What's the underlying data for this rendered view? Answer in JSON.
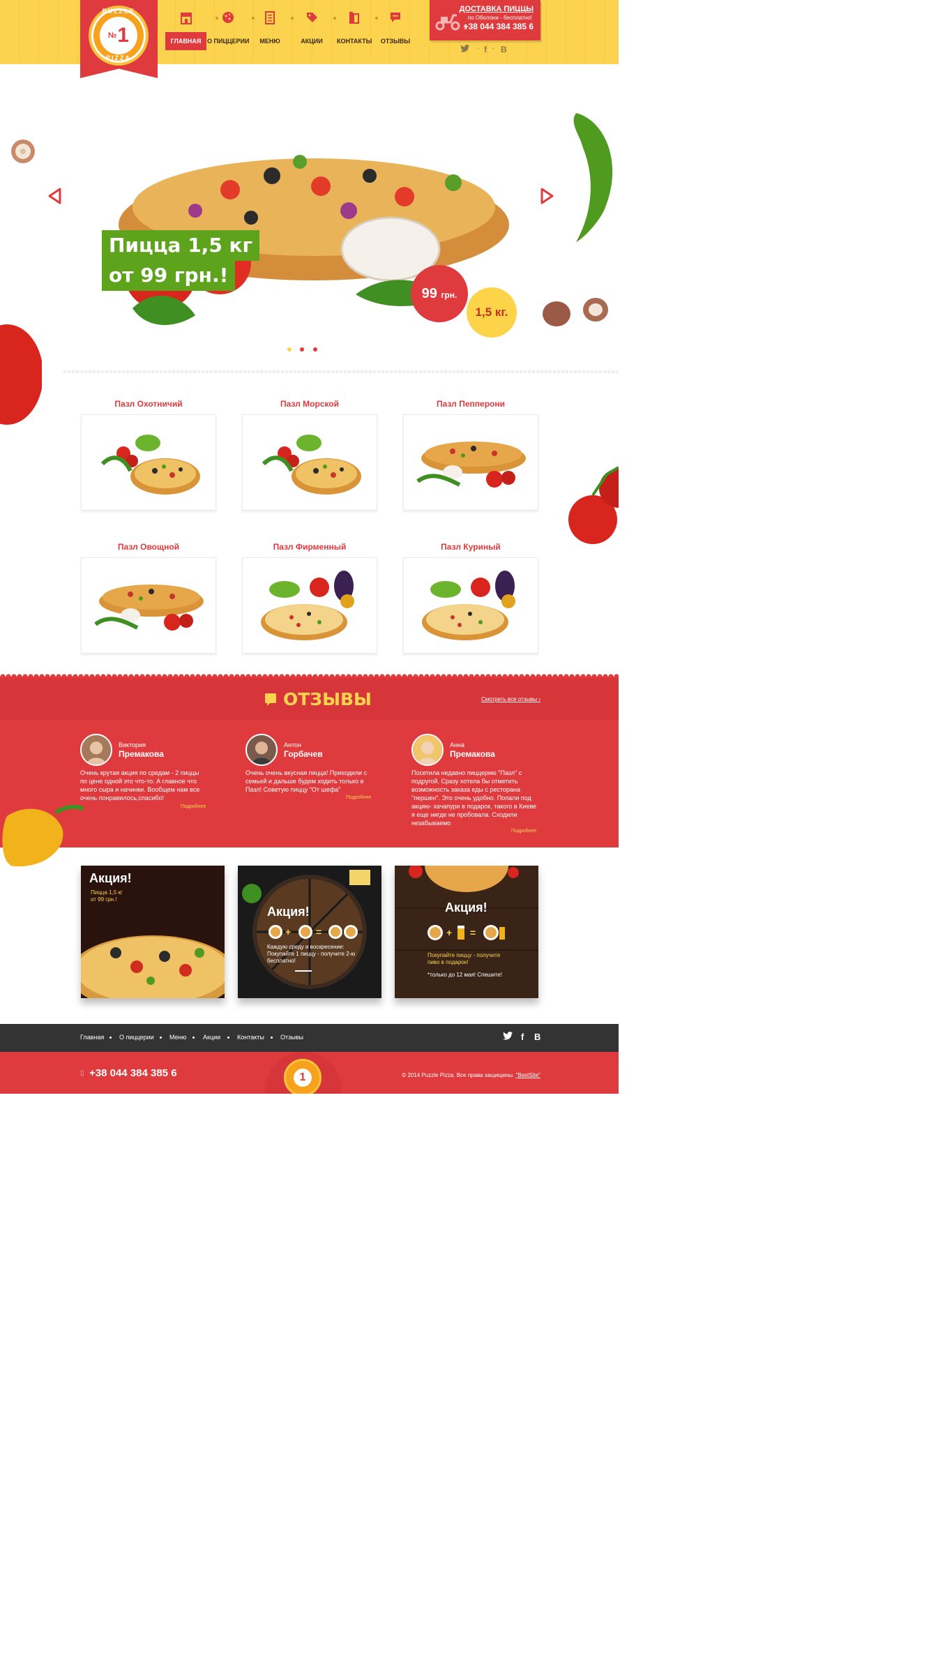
{
  "logo": {
    "top_text": "PUZZLE",
    "number": "1",
    "no": "№",
    "bottom_text": "PIZZA"
  },
  "nav": [
    {
      "label": "ГЛАВНАЯ",
      "icon": "store-icon",
      "active": true
    },
    {
      "label": "О ПИЦЦЕРИИ",
      "icon": "pizza-icon",
      "active": false
    },
    {
      "label": "МЕНЮ",
      "icon": "menu-list-icon",
      "active": false
    },
    {
      "label": "АКЦИИ",
      "icon": "tag-icon",
      "active": false
    },
    {
      "label": "КОНТАКТЫ",
      "icon": "phone-icon",
      "active": false
    },
    {
      "label": "ОТЗЫВЫ",
      "icon": "chat-icon",
      "active": false
    }
  ],
  "delivery": {
    "title": "ДОСТАВКА ПИЦЦЫ",
    "subtitle": "по Оболони - бесплатно!",
    "phone": "+38 044 384 385 6"
  },
  "social": {
    "twitter": "twitter-icon",
    "facebook": "f",
    "vk": "В"
  },
  "hero": {
    "line1": "Пицца 1,5 кг",
    "line2": "от 99 грн.!",
    "price": "99",
    "price_unit": "грн.",
    "weight": "1,5 кг."
  },
  "products": [
    {
      "name": "Пазл Охотничий"
    },
    {
      "name": "Пазл Морской"
    },
    {
      "name": "Пазл Пепперони"
    },
    {
      "name": "Пазл Овощной"
    },
    {
      "name": "Пазл Фирменный"
    },
    {
      "name": "Пазл Куриный"
    }
  ],
  "reviews": {
    "title": "ОТЗЫВЫ",
    "see_all": "Смотреть все отзывы ›",
    "items": [
      {
        "first": "Виктория",
        "last": "Премакова",
        "text": "Очень крутая акция по средам - 2 пиццы по цене одной это что-то. А главное что много сыра и начинки. Вообщем нам все очень понравилось,спасибо!",
        "more": "Подробнее"
      },
      {
        "first": "Антон",
        "last": "Горбачев",
        "text": "Очень очень вкусная пицца! Приходили с семьей и дальше будем ходить только в Пазл! Советую пиццу \"От шефа\"",
        "more": "Подробнее"
      },
      {
        "first": "Анна",
        "last": "Премакова",
        "text": "Посетила недавно пиццерию \"Пазл\" с подругой. Сразу хотела бы отметить возможность заказа еды с ресторана \"першен\". Это очень удобно. Попали под акцию- хачапури в подарок, такого в Киеве я еще нигде не пробовала. Сходили незабываемо",
        "more": "Подробнее"
      }
    ]
  },
  "promos": [
    {
      "title": "Акция!",
      "text1": "Пицца 1,5 кг",
      "text2": "от 99 грн.!"
    },
    {
      "title": "Акция!",
      "text": "Каждую среду и воскресение: Покупайте 1 пиццу - получите 2-ю бесплатно!"
    },
    {
      "title": "Акция!",
      "text": "Покупайте пиццу - получите пиво в подарок!",
      "note": "*только до 12 мая! Спешите!"
    }
  ],
  "footer": {
    "links": [
      "Главная",
      "О пиццерии",
      "Меню",
      "Акции",
      "Контакты",
      "Отзывы"
    ],
    "phone": "+38 044 384 385 6",
    "copyright": "© 2014 Puzzle Pizza. Все права защищены.",
    "bestsite": "\"BestSite\""
  },
  "colors": {
    "red": "#df3a3d",
    "yellow": "#fcd34f",
    "green": "#5da31c",
    "dark": "#333333"
  }
}
